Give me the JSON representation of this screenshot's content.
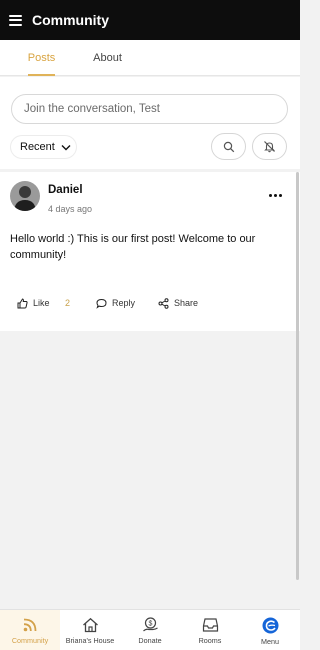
{
  "header": {
    "title": "Community",
    "menu_icon": "hamburger-icon"
  },
  "tabs": [
    {
      "label": "Posts",
      "active": true
    },
    {
      "label": "About",
      "active": false
    }
  ],
  "composer": {
    "placeholder": "Join the conversation, Test"
  },
  "filter": {
    "sort_label": "Recent",
    "sort_icon": "chevron-down-icon",
    "search_icon": "search-icon",
    "notify_icon": "bell-off-icon"
  },
  "post": {
    "author": "Daniel",
    "time": "4 days ago",
    "body": "Hello world :) This is our first post! Welcome to our community!",
    "like_label": "Like",
    "like_count": "2",
    "reply_label": "Reply",
    "share_label": "Share"
  },
  "bottom_nav": [
    {
      "label": "Community",
      "icon": "rss-icon",
      "active": true
    },
    {
      "label": "Briana's House",
      "icon": "home-icon",
      "active": false
    },
    {
      "label": "Donate",
      "icon": "donate-icon",
      "active": false
    },
    {
      "label": "Rooms",
      "icon": "inbox-icon",
      "active": false
    },
    {
      "label": "Menu",
      "icon": "brand-logo-icon",
      "active": false
    }
  ],
  "colors": {
    "accent": "#d9a441",
    "appbar": "#0d0d0d",
    "background": "#f2f2f2",
    "brand_blue": "#1565d8"
  }
}
